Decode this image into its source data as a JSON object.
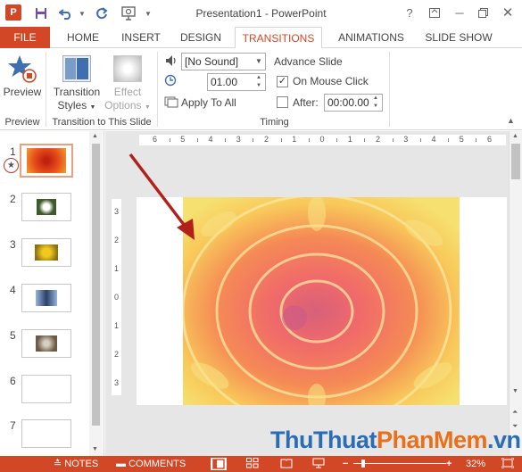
{
  "window": {
    "title": "Presentation1 - PowerPoint",
    "app_logo": "P",
    "accent_color": "#d24726"
  },
  "qat": {
    "save_icon": "save-icon",
    "undo_icon": "undo-icon",
    "redo_icon": "repeat-icon",
    "slideshow_icon": "start-slideshow-icon"
  },
  "window_controls": [
    "help",
    "ribbon-display",
    "minimize",
    "restore",
    "close"
  ],
  "tabs": [
    {
      "label": "FILE"
    },
    {
      "label": "HOME"
    },
    {
      "label": "INSERT"
    },
    {
      "label": "DESIGN"
    },
    {
      "label": "TRANSITIONS",
      "active": true
    },
    {
      "label": "ANIMATIONS"
    },
    {
      "label": "SLIDE SHOW"
    }
  ],
  "ribbon": {
    "preview": {
      "button_label": "Preview",
      "group_label": "Preview"
    },
    "transition_group": {
      "styles_label_line1": "Transition",
      "styles_label_line2": "Styles",
      "effect_label_line1": "Effect",
      "effect_label_line2": "Options",
      "group_label": "Transition to This Slide"
    },
    "timing": {
      "sound_value": "[No Sound]",
      "duration_value": "01.00",
      "apply_to_all_label": "Apply To All",
      "advance_slide_label": "Advance Slide",
      "on_mouse_click_label": "On Mouse Click",
      "on_mouse_click_checked": true,
      "after_label": "After:",
      "after_checked": false,
      "after_value": "00:00.00",
      "group_label": "Timing"
    }
  },
  "slides": [
    {
      "number": "1",
      "selected": true,
      "has_transition": true,
      "thumb_color": "#e0401a"
    },
    {
      "number": "2",
      "thumb_color": "#3d5a2a"
    },
    {
      "number": "3",
      "thumb_color": "#e8b010"
    },
    {
      "number": "4",
      "thumb_color": "#3b5d8a"
    },
    {
      "number": "5",
      "thumb_color": "#6b5a48"
    },
    {
      "number": "6"
    },
    {
      "number": "7"
    }
  ],
  "ruler": {
    "horizontal_ticks": [
      "6",
      "5",
      "4",
      "3",
      "2",
      "1",
      "0",
      "1",
      "2",
      "3",
      "4",
      "5",
      "6"
    ],
    "vertical_ticks": [
      "3",
      "2",
      "1",
      "0",
      "1",
      "2",
      "3"
    ]
  },
  "status_bar": {
    "notes_label": "NOTES",
    "comments_label": "COMMENTS",
    "zoom_label": "32%"
  },
  "watermark": {
    "part1": "ThuThuat",
    "part2": "PhanMem",
    "part3": ".vn",
    "color_dark": "#2a6db5",
    "color_orange": "#e8701a"
  }
}
